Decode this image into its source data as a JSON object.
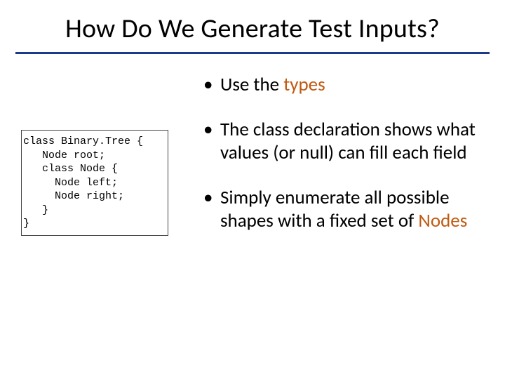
{
  "title": "How Do We Generate Test Inputs?",
  "code": {
    "l1": "class Binary.Tree {",
    "l2": "   Node root;",
    "l3": "   class Node {",
    "l4": "     Node left;",
    "l5": "     Node right;",
    "l6": "   }",
    "l7": "}"
  },
  "bullets": {
    "b1a": "Use the ",
    "b1b": "types",
    "b2": "The class declaration shows what values (or null) can fill each field",
    "b3a": "Simply enumerate all possible shapes with a fixed set of ",
    "b3b": "Nodes"
  }
}
